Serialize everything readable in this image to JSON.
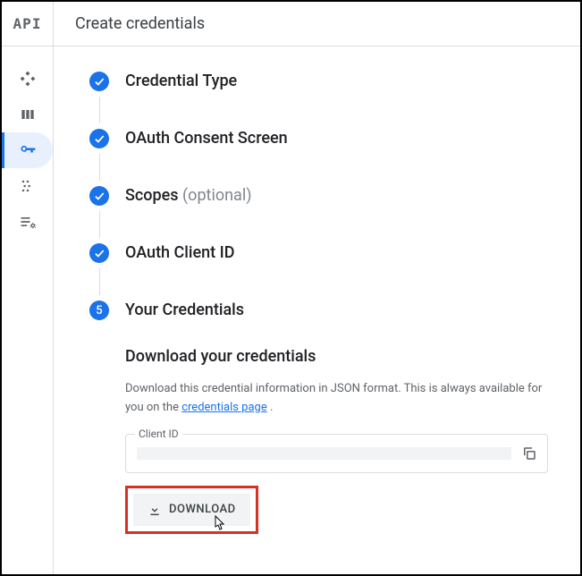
{
  "logo": "API",
  "header": {
    "title": "Create credentials"
  },
  "nav": {
    "items": [
      {
        "name": "dashboard",
        "active": false
      },
      {
        "name": "library",
        "active": false
      },
      {
        "name": "credentials",
        "active": true
      },
      {
        "name": "consent",
        "active": false
      },
      {
        "name": "settings",
        "active": false
      }
    ]
  },
  "steps": [
    {
      "label": "Credential Type",
      "done": true
    },
    {
      "label": "OAuth Consent Screen",
      "done": true
    },
    {
      "label": "Scopes",
      "optional": "(optional)",
      "done": true
    },
    {
      "label": "OAuth Client ID",
      "done": true
    },
    {
      "number": "5",
      "label": "Your Credentials",
      "done": false
    }
  ],
  "section": {
    "heading": "Download your credentials",
    "description_prefix": "Download this credential information in JSON format. This is always available for you on the ",
    "link_text": "credentials page",
    "description_suffix": " ."
  },
  "field": {
    "label": "Client ID",
    "value": ""
  },
  "buttons": {
    "download": "DOWNLOAD"
  },
  "colors": {
    "accent": "#1a73e8",
    "highlight_border": "#d93025"
  }
}
